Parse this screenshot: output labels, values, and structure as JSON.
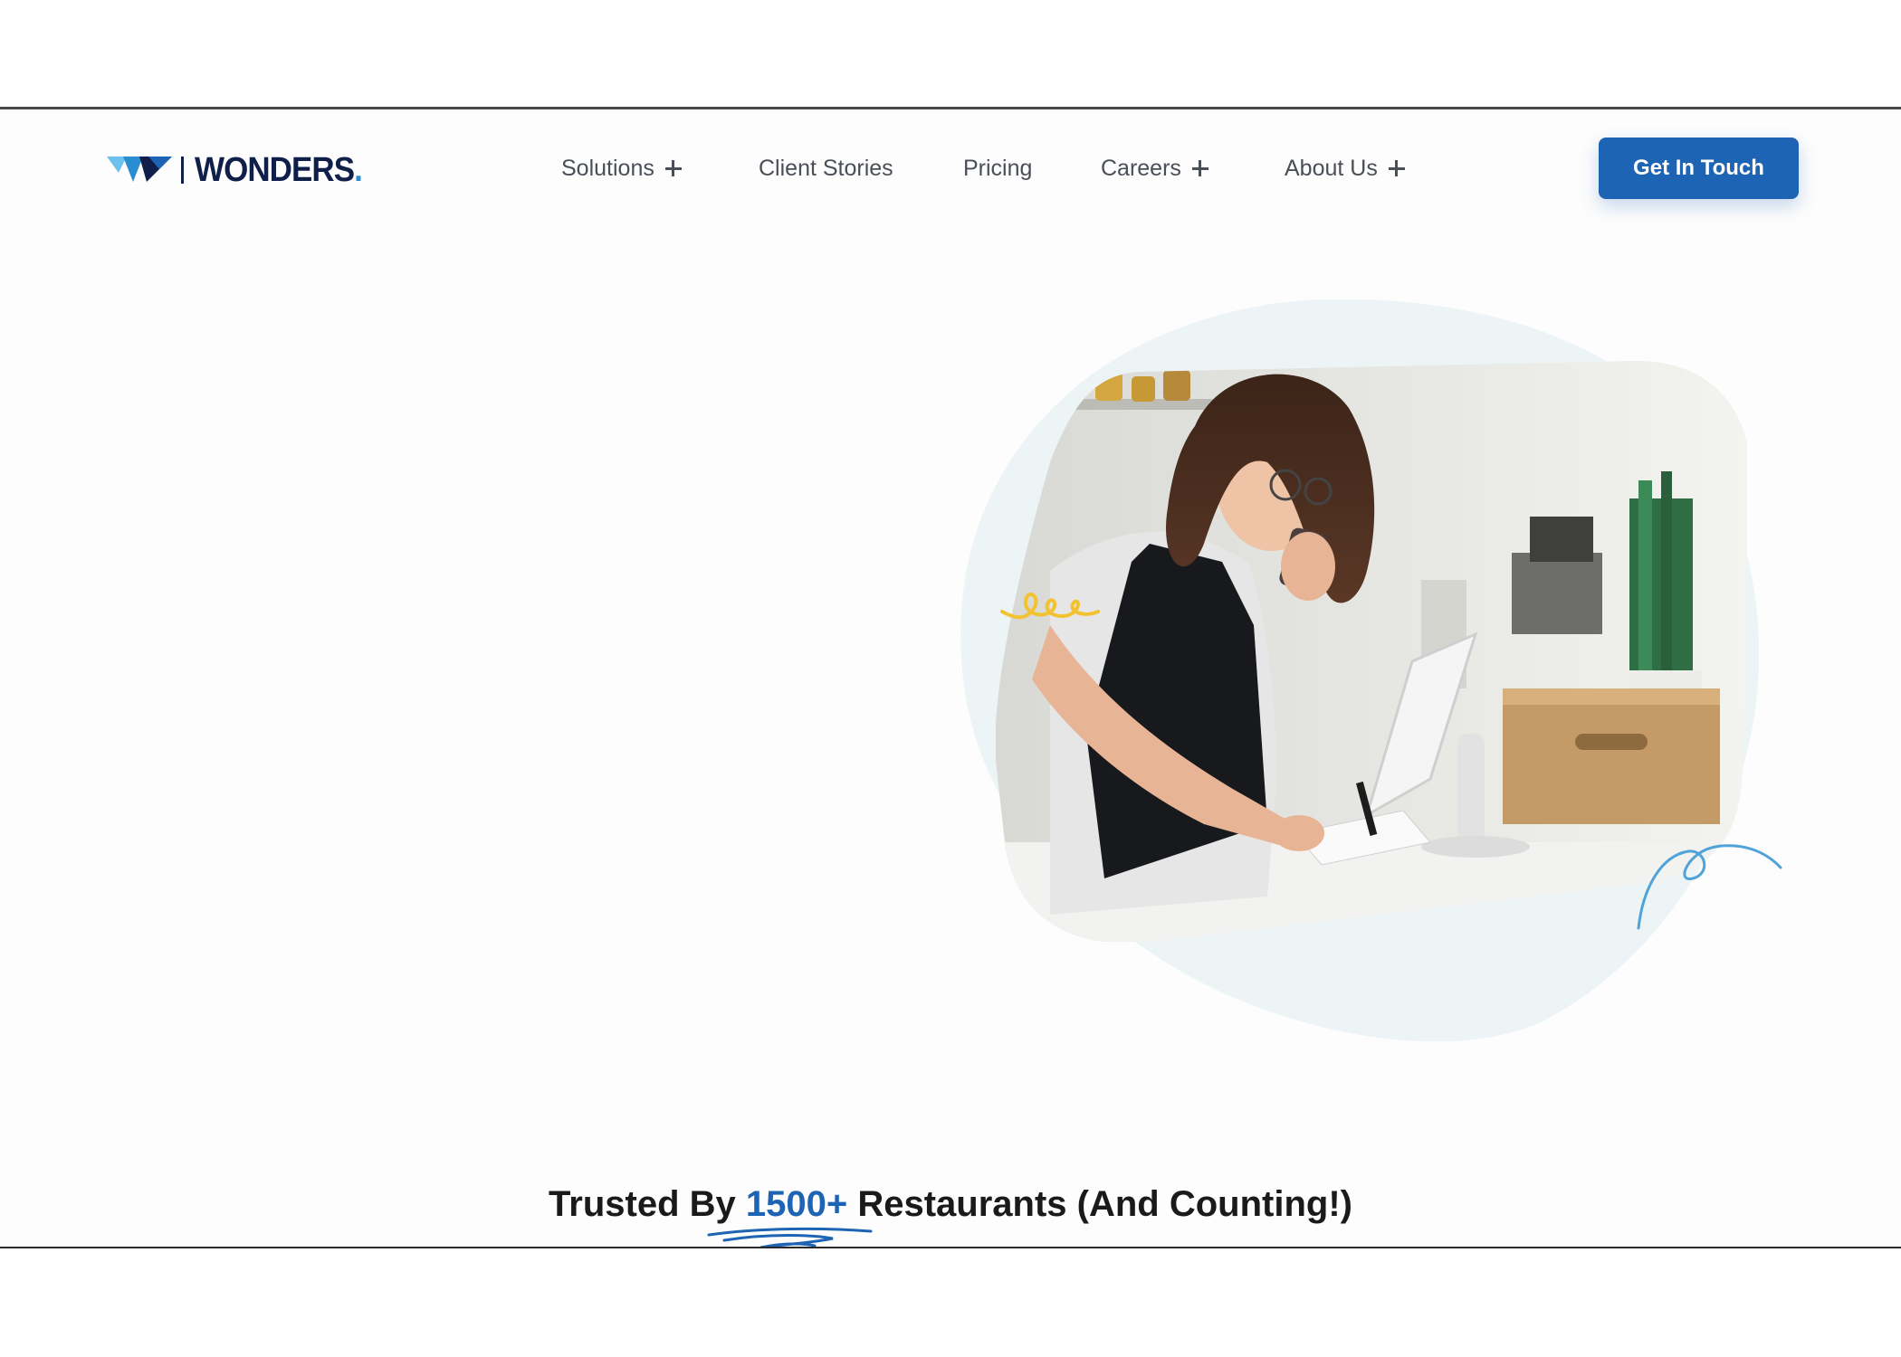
{
  "brand": {
    "name": "WONDERS",
    "dot": "."
  },
  "nav": {
    "items": [
      {
        "label": "Solutions",
        "has_submenu": true
      },
      {
        "label": "Client Stories",
        "has_submenu": false
      },
      {
        "label": "Pricing",
        "has_submenu": false
      },
      {
        "label": "Careers",
        "has_submenu": true
      },
      {
        "label": "About Us",
        "has_submenu": true
      }
    ],
    "cta_label": "Get In Touch"
  },
  "hero": {
    "image_icon": "restaurant-worker-photo"
  },
  "trusted": {
    "prefix": "Trusted By",
    "highlight": "1500+",
    "suffix": "Restaurants (And Counting!)"
  },
  "colors": {
    "brand_navy": "#0f1f4a",
    "accent_blue": "#1e64b4",
    "logo_light_blue": "#2a8cd1",
    "blob_bg": "#edf4f6",
    "squiggle_yellow": "#f2c230"
  }
}
